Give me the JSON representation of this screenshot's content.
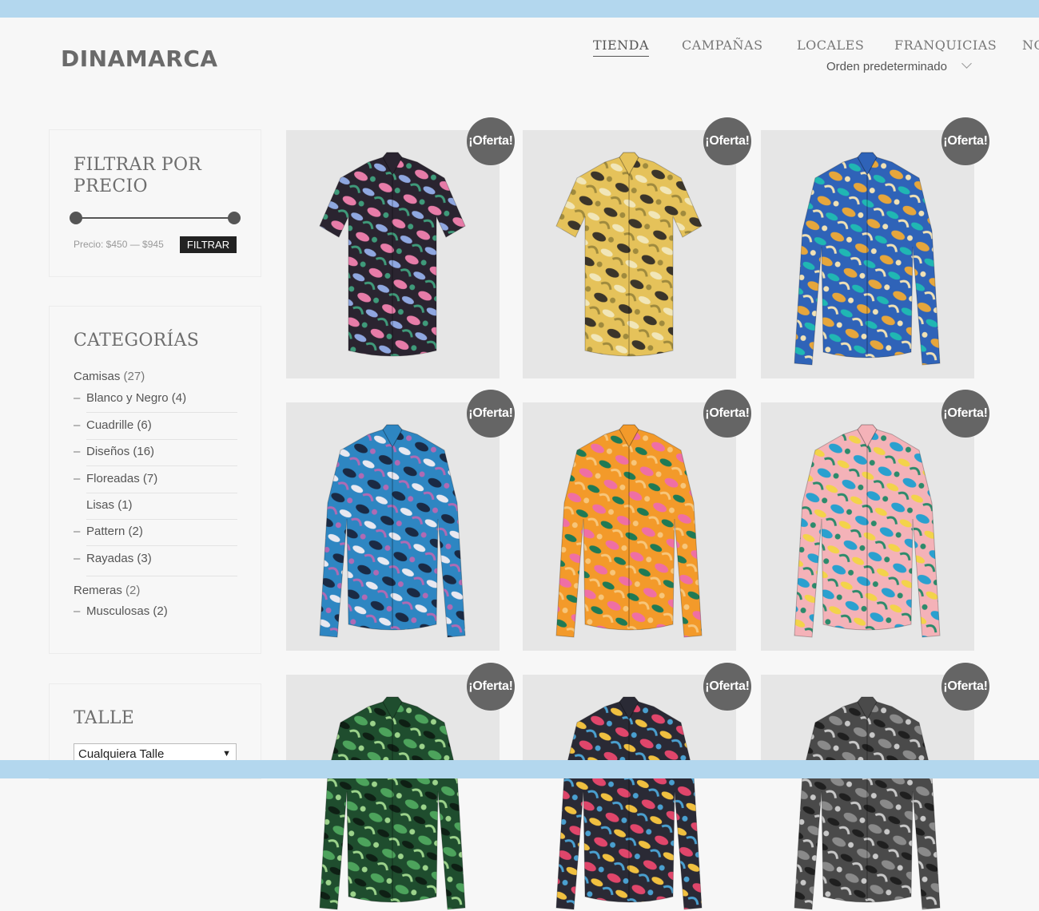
{
  "site": {
    "logo": "DINAMARCA"
  },
  "nav": {
    "items": [
      {
        "label": "TIENDA",
        "active": true
      },
      {
        "label": "CAMPAÑAS"
      },
      {
        "label": "LOCALES"
      },
      {
        "label": "FRANQUICIAS"
      },
      {
        "label": "NO"
      }
    ]
  },
  "ordering": {
    "selected": "Orden predeterminado"
  },
  "price_filter": {
    "title_line1": "FILTRAR POR",
    "title_line2": "PRECIO",
    "label": "Precio: $450 — $945",
    "button": "FILTRAR",
    "min": 450,
    "max": 945
  },
  "categories": {
    "title": "CATEGORÍAS",
    "items": [
      {
        "name": "Camisas",
        "count": "(27)"
      },
      {
        "name": "Blanco y Negro",
        "count": "(4)",
        "sub": true
      },
      {
        "name": "Cuadrille",
        "count": "(6)",
        "sub": true
      },
      {
        "name": "Diseños",
        "count": "(16)",
        "sub": true
      },
      {
        "name": "Floreadas",
        "count": "(7)",
        "sub": true
      },
      {
        "name": "Lisas",
        "count": "(1)",
        "sub": true
      },
      {
        "name": "Pattern",
        "count": "(2)",
        "sub": true
      },
      {
        "name": "Rayadas",
        "count": "(3)",
        "sub": true
      },
      {
        "name": "Remeras",
        "count": "(2)"
      },
      {
        "name": "Musculosas",
        "count": "(2)",
        "sub": true
      }
    ]
  },
  "size_filter": {
    "title": "TALLE",
    "selected": "Cualquiera Talle"
  },
  "products": {
    "badge": "¡Oferta!",
    "items": [
      {
        "sleeve": "short",
        "colors": [
          "#2a2430",
          "#e77ca8",
          "#8fa7e0",
          "#3f9a7a"
        ]
      },
      {
        "sleeve": "short",
        "colors": [
          "#e5c25a",
          "#3b352a",
          "#f1e6b8",
          "#9f8a3d"
        ]
      },
      {
        "sleeve": "long",
        "colors": [
          "#2f63b8",
          "#e6a63c",
          "#20b7b3",
          "#f0e1b5"
        ]
      },
      {
        "sleeve": "long",
        "colors": [
          "#2e86c2",
          "#1a2a44",
          "#e8e8f0",
          "#b06ab3"
        ]
      },
      {
        "sleeve": "long",
        "colors": [
          "#f39a2a",
          "#ef6fa4",
          "#1f7a55",
          "#f7c67a"
        ]
      },
      {
        "sleeve": "long",
        "colors": [
          "#f4b2b8",
          "#2aa0cf",
          "#f3d34a",
          "#2c8a6b"
        ]
      },
      {
        "sleeve": "long",
        "colors": [
          "#1f4d2e",
          "#4da35c",
          "#0e1f14",
          "#9cd38b"
        ]
      },
      {
        "sleeve": "long",
        "colors": [
          "#2a2a35",
          "#e0466b",
          "#f0c040",
          "#4aa0d0"
        ]
      },
      {
        "sleeve": "long",
        "colors": [
          "#4a4a4a",
          "#8a8a8a",
          "#1f1f1f",
          "#c8c8c8"
        ]
      }
    ]
  }
}
